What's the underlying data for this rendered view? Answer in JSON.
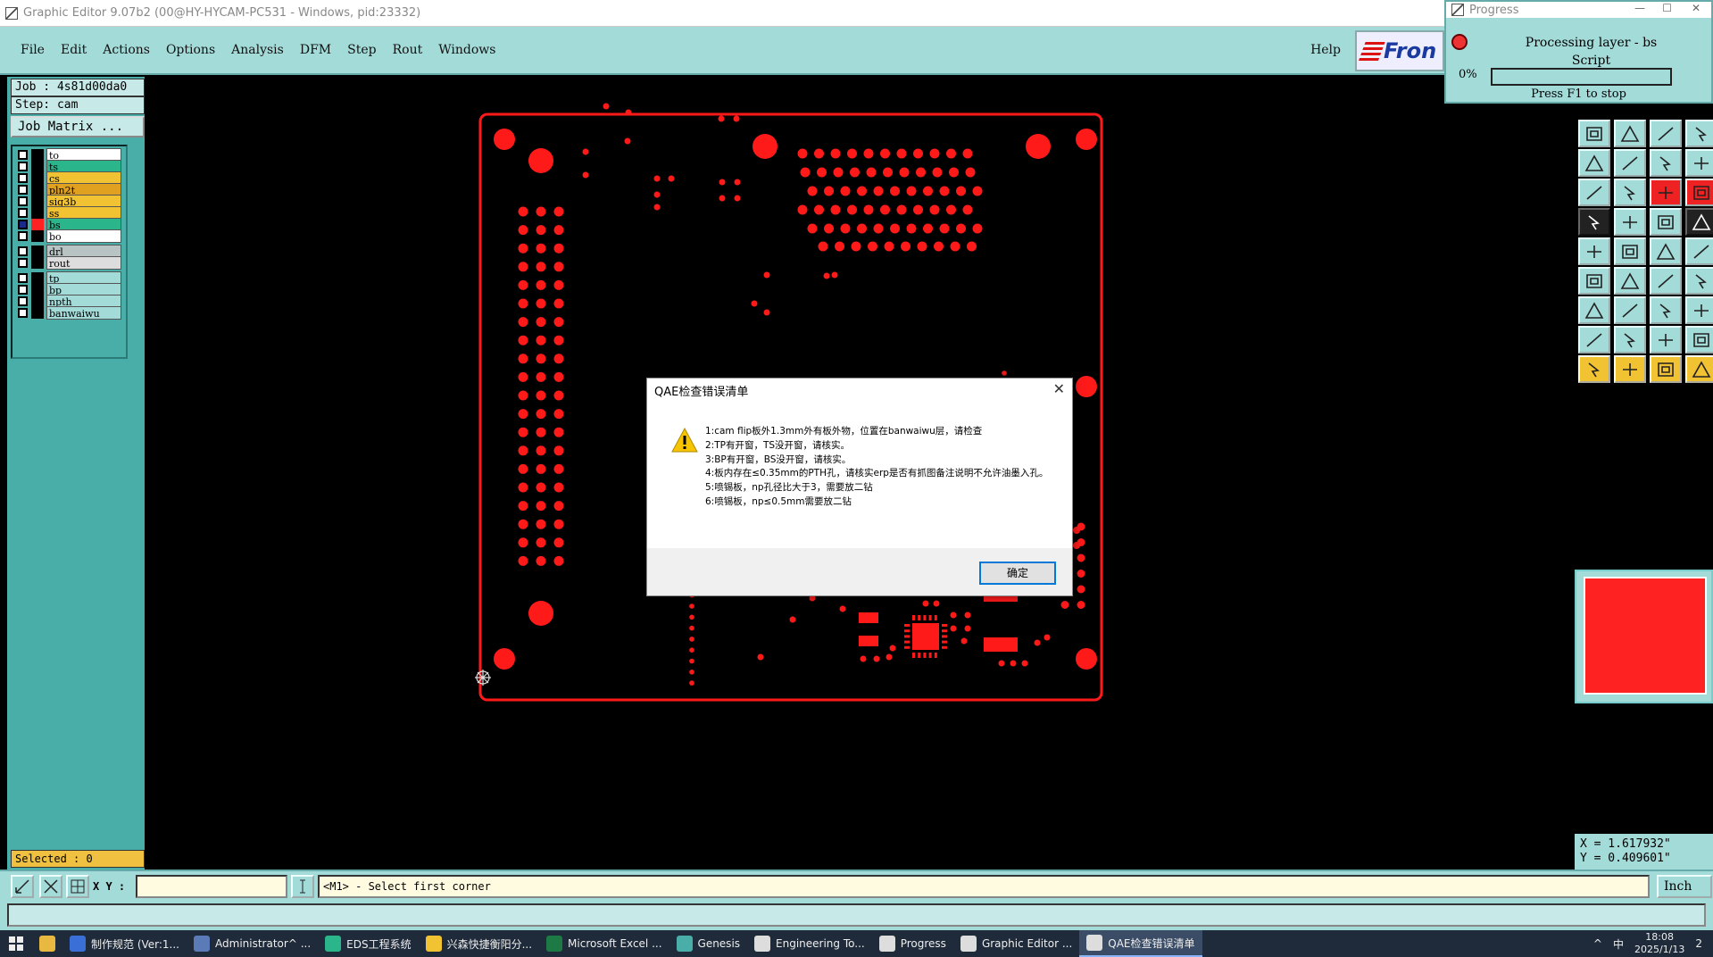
{
  "window": {
    "title": "Graphic Editor 9.07b2 (00@HY-HYCAM-PC531 - Windows, pid:23332)"
  },
  "menu": {
    "items": [
      "File",
      "Edit",
      "Actions",
      "Options",
      "Analysis",
      "DFM",
      "Step",
      "Rout",
      "Windows"
    ],
    "help": "Help",
    "logo_text": "Fron"
  },
  "left": {
    "job": "Job : 4s81d00da0",
    "step": "Step: cam",
    "job_matrix": "Job Matrix ...",
    "layers": [
      {
        "name": "to",
        "color": "#ffffff",
        "swatch": "#000000"
      },
      {
        "name": "ts",
        "color": "#2bb58a",
        "swatch": "#000000"
      },
      {
        "name": "cs",
        "color": "#f1c232",
        "swatch": "#000000"
      },
      {
        "name": "pln2t",
        "color": "#e0a020",
        "swatch": "#000000"
      },
      {
        "name": "sig3b",
        "color": "#f1c232",
        "swatch": "#000000"
      },
      {
        "name": "ss",
        "color": "#f1c232",
        "swatch": "#000000"
      },
      {
        "name": "bs",
        "color": "#2bb58a",
        "swatch": "#ff2222",
        "selected": true
      },
      {
        "name": "bo",
        "color": "#ffffff",
        "swatch": "#000000"
      },
      {
        "name": "drl",
        "color": "#b8c4c4",
        "swatch": "#000000"
      },
      {
        "name": "rout",
        "color": "#dddddd",
        "swatch": "#000000"
      },
      {
        "name": "tp",
        "color": "#a3dbd9",
        "swatch": "#000000"
      },
      {
        "name": "bp",
        "color": "#a3dbd9",
        "swatch": "#000000"
      },
      {
        "name": "npth",
        "color": "#a3dbd9",
        "swatch": "#000000"
      },
      {
        "name": "banwaiwu",
        "color": "#a3dbd9",
        "swatch": "#000000"
      }
    ],
    "selected": "Selected : 0"
  },
  "progress": {
    "title": "Progress",
    "message_line1": "Processing layer - bs",
    "message_line2": "Script",
    "percent": "0%",
    "progress_value": 0,
    "stop_hint": "Press F1 to stop"
  },
  "dialog": {
    "title": "QAE检查错误清单",
    "lines": [
      "1:cam flip板外1.3mm外有板外物，位置在banwaiwu层，请检查",
      "2:TP有开窗，TS没开窗，请核实。",
      "3:BP有开窗，BS没开窗，请核实。",
      "4:板内存在≤0.35mm的PTH孔，请核实erp是否有抓图备注说明不允许油墨入孔。",
      "5:喷锡板，np孔径比大于3，需要放二钻",
      "6:喷锡板，np≤0.5mm需要放二钻"
    ],
    "ok": "确定"
  },
  "coords": {
    "x": "X = 1.617932\"",
    "y": "Y = 0.409601\""
  },
  "command": {
    "xy_label": "X Y :",
    "xy_value": "",
    "status": "<M1> - Select first corner",
    "units": "Inch"
  },
  "taskbar": {
    "items": [
      {
        "label": "制作规范 (Ver:1...",
        "color": "#3a6fd8"
      },
      {
        "label": "Administrator^ ...",
        "color": "#5a7ab8"
      },
      {
        "label": "EDS工程系统",
        "color": "#2bb58a"
      },
      {
        "label": "兴森快捷衡阳分...",
        "color": "#f1c232"
      },
      {
        "label": "Microsoft Excel ...",
        "color": "#1d7a45"
      },
      {
        "label": "Genesis",
        "color": "#4aaea8"
      },
      {
        "label": "Engineering To...",
        "color": "#dddddd"
      },
      {
        "label": "Progress",
        "color": "#dddddd"
      },
      {
        "label": "Graphic Editor ...",
        "color": "#dddddd"
      },
      {
        "label": "QAE检查错误清单",
        "color": "#dddddd",
        "active": true
      }
    ],
    "ime": "中",
    "time": "18:08",
    "date": "2025/1/13",
    "notify_count": "2"
  }
}
